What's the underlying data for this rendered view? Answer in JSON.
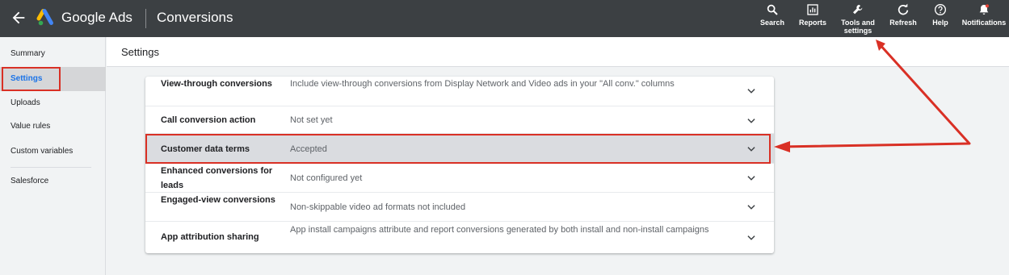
{
  "header": {
    "app_name": "Google Ads",
    "section": "Conversions",
    "actions": [
      {
        "icon": "search-icon",
        "label_lines": [
          "Search"
        ]
      },
      {
        "icon": "reports-icon",
        "label_lines": [
          "Reports"
        ]
      },
      {
        "icon": "wrench-icon",
        "label_lines": [
          "Tools and",
          "settings"
        ]
      },
      {
        "icon": "refresh-icon",
        "label_lines": [
          "Refresh"
        ]
      },
      {
        "icon": "help-icon",
        "label_lines": [
          "Help"
        ]
      },
      {
        "icon": "bell-icon",
        "label_lines": [
          "Notifications"
        ]
      }
    ]
  },
  "sidebar": {
    "items": [
      {
        "label": "Summary"
      },
      {
        "label": "Settings",
        "active": true
      },
      {
        "label": "Uploads"
      },
      {
        "label": "Value rules"
      },
      {
        "label": "Custom variables"
      },
      {
        "label": "Salesforce"
      }
    ]
  },
  "content": {
    "title": "Settings",
    "rows": [
      {
        "label": "View-through conversions",
        "value": "Include view-through conversions from Display Network and Video ads in your \"All conv.\" columns"
      },
      {
        "label": "Call conversion action",
        "value": "Not set yet"
      },
      {
        "label": "Customer data terms",
        "value": "Accepted",
        "selected": true
      },
      {
        "label": "Enhanced conversions for leads",
        "value": "Not configured yet"
      },
      {
        "label": "Engaged-view conversions",
        "value": "Non-skippable video ad formats not included"
      },
      {
        "label": "App attribution sharing",
        "value": "App install campaigns attribute and report conversions generated by both install and non-install campaigns"
      }
    ]
  },
  "colors": {
    "header_bg": "#3c4043",
    "accent_blue": "#1a73e8",
    "annotation_red": "#d93025"
  }
}
